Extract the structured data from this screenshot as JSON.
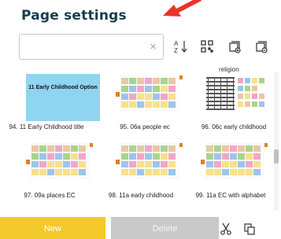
{
  "title": "Page settings",
  "search": {
    "value": "",
    "clear_icon": "close-icon"
  },
  "toolbar": {
    "sort_icon": "sort-az-icon",
    "qr_icon": "qr-code-icon",
    "import_icon": "import-page-icon",
    "export_icon": "export-page-icon"
  },
  "partial_label": "religion",
  "pages": [
    {
      "label": "94. 11 Early Childhood title",
      "thumb_type": "title",
      "thumb_text": "11 Early Childhood Option"
    },
    {
      "label": "95. 06a people ec",
      "thumb_type": "symbol-grid"
    },
    {
      "label": "96. 06c early childhood",
      "thumb_type": "table-grid"
    },
    {
      "label": "97. 09a places EC",
      "thumb_type": "symbol-grid"
    },
    {
      "label": "98. 11a early childhood",
      "thumb_type": "symbol-grid"
    },
    {
      "label": "99. 11a EC with alphabet",
      "thumb_type": "symbol-grid"
    }
  ],
  "buttons": {
    "new_label": "New",
    "delete_label": "Delete"
  },
  "actions": {
    "cut_icon": "scissors-icon",
    "copy_icon": "copy-icon"
  },
  "colors": {
    "title": "#163d50",
    "new_button": "#f2c92a",
    "delete_button": "#c9c9c9",
    "title_thumb": "#8fd4f0",
    "arrow": "#e8342a"
  }
}
